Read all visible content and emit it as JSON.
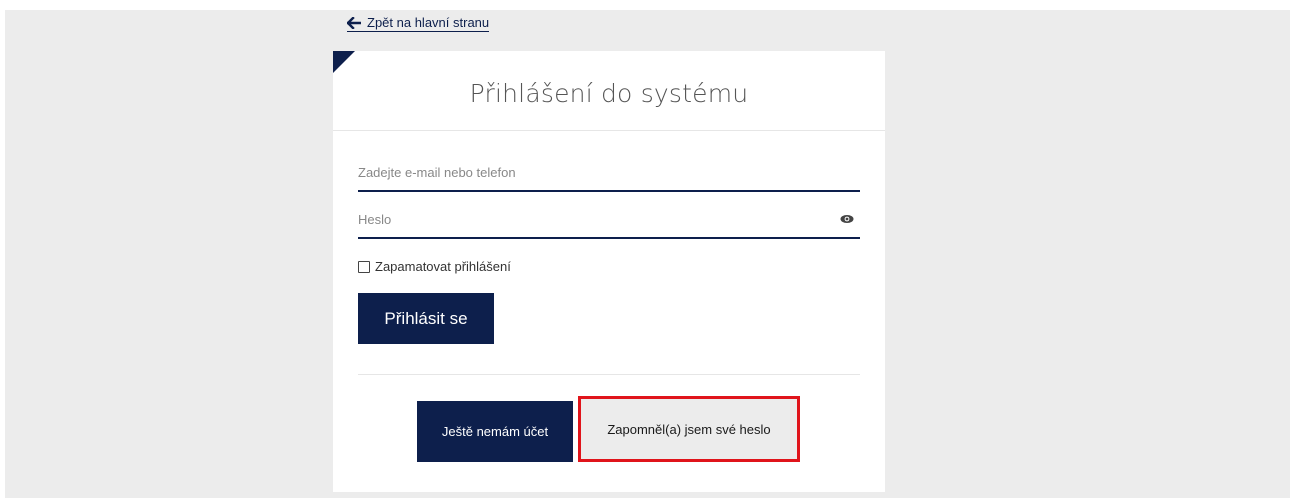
{
  "back_link": {
    "label": "Zpět na hlavní stranu",
    "icon": "arrow-left-icon"
  },
  "login": {
    "title": "Přihlášení do systému",
    "email_placeholder": "Zadejte e-mail nebo telefon",
    "password_placeholder": "Heslo",
    "remember_label": "Zapamatovat přihlášení",
    "remember_checked": false,
    "submit_label": "Přihlásit se",
    "register_label": "Ještě nemám účet",
    "forgot_label": "Zapomněl(a) jsem své heslo"
  },
  "colors": {
    "primary": "#0d1f4c",
    "background": "#ececec",
    "highlight": "#e0141b"
  }
}
